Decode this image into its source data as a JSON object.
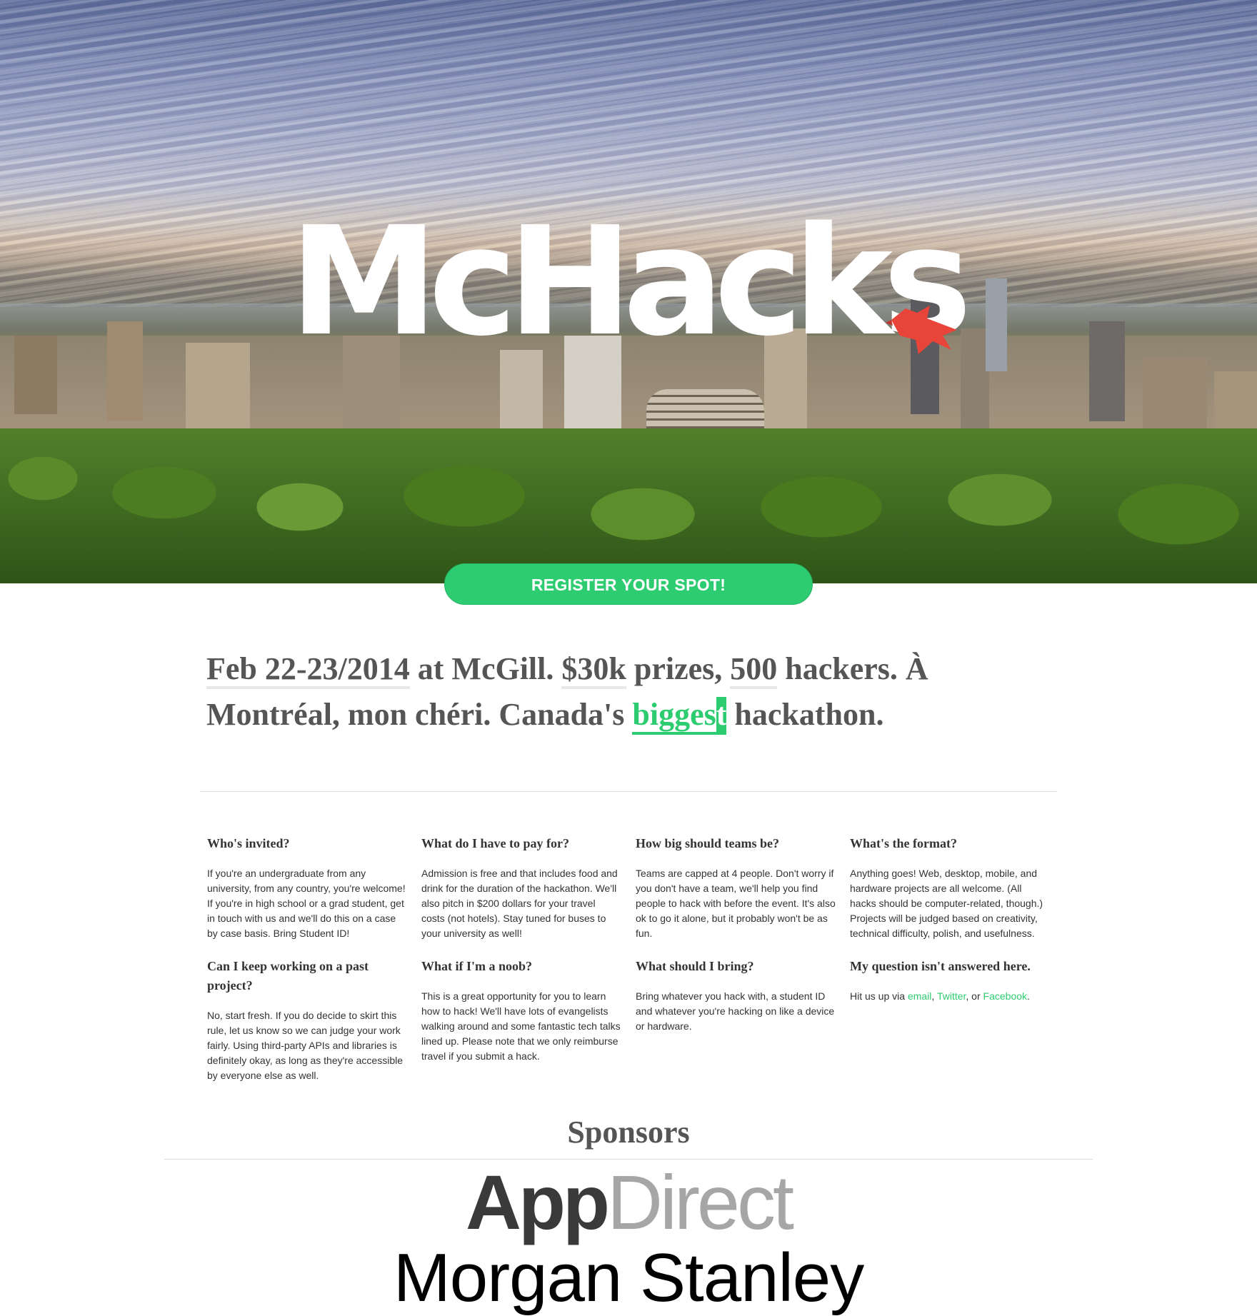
{
  "hero": {
    "logo_text": "McHacks",
    "register_label": "REGISTER YOUR SPOT!"
  },
  "tagline": {
    "date": "Feb 22-23/2014",
    "at": " at McGill. ",
    "prize": "$30k",
    "prizes_text": " prizes, ",
    "hackers_count": "500",
    "hackers_text": " hackers. À Montréal, mon chéri. Canada's ",
    "biggest_a": "bigges",
    "biggest_b": "t",
    "end": " hackathon."
  },
  "faq": [
    {
      "q": "Who's invited?",
      "a": "If you're an undergraduate from any university, from any country, you're welcome! If you're in high school or a grad student, get in touch with us and we'll do this on a case by case basis. Bring Student ID!"
    },
    {
      "q": "What do I have to pay for?",
      "a": "Admission is free and that includes food and drink for the duration of the hackathon. We'll also pitch in $200 dollars for your travel costs (not hotels). Stay tuned for buses to your university as well!"
    },
    {
      "q": "How big should teams be?",
      "a": "Teams are capped at 4 people. Don't worry if you don't have a team, we'll help you find people to hack with before the event. It's also ok to go it alone, but it probably won't be as fun."
    },
    {
      "q": "What's the format?",
      "a": "Anything goes! Web, desktop, mobile, and hardware projects are all welcome. (All hacks should be computer-related, though.) Projects will be judged based on creativity, technical difficulty, polish, and usefulness."
    },
    {
      "q": "Can I keep working on a past project?",
      "a": "No, start fresh. If you do decide to skirt this rule, let us know so we can judge your work fairly. Using third-party APIs and libraries is definitely okay, as long as they're accessible by everyone else as well."
    },
    {
      "q": "What if I'm a noob?",
      "a": "This is a great opportunity for you to learn how to hack! We'll have lots of evangelists walking around and some fantastic tech talks lined up. Please note that we only reimburse travel if you submit a hack."
    },
    {
      "q": "What should I bring?",
      "a": "Bring whatever you hack with, a student ID and whatever you're hacking on like a device or hardware."
    },
    {
      "q": "My question isn't answered here.",
      "a_prefix": "Hit us up via ",
      "email": "email",
      "comma": ", ",
      "twitter": "Twitter",
      "or": ", or ",
      "facebook": "Facebook",
      "period": "."
    }
  ],
  "sponsors": {
    "title": "Sponsors",
    "appdirect_a": "App",
    "appdirect_b": "Direct",
    "morgan": "Morgan Stanley"
  },
  "colors": {
    "accent": "#2ecc71",
    "bird": "#e8443a"
  }
}
